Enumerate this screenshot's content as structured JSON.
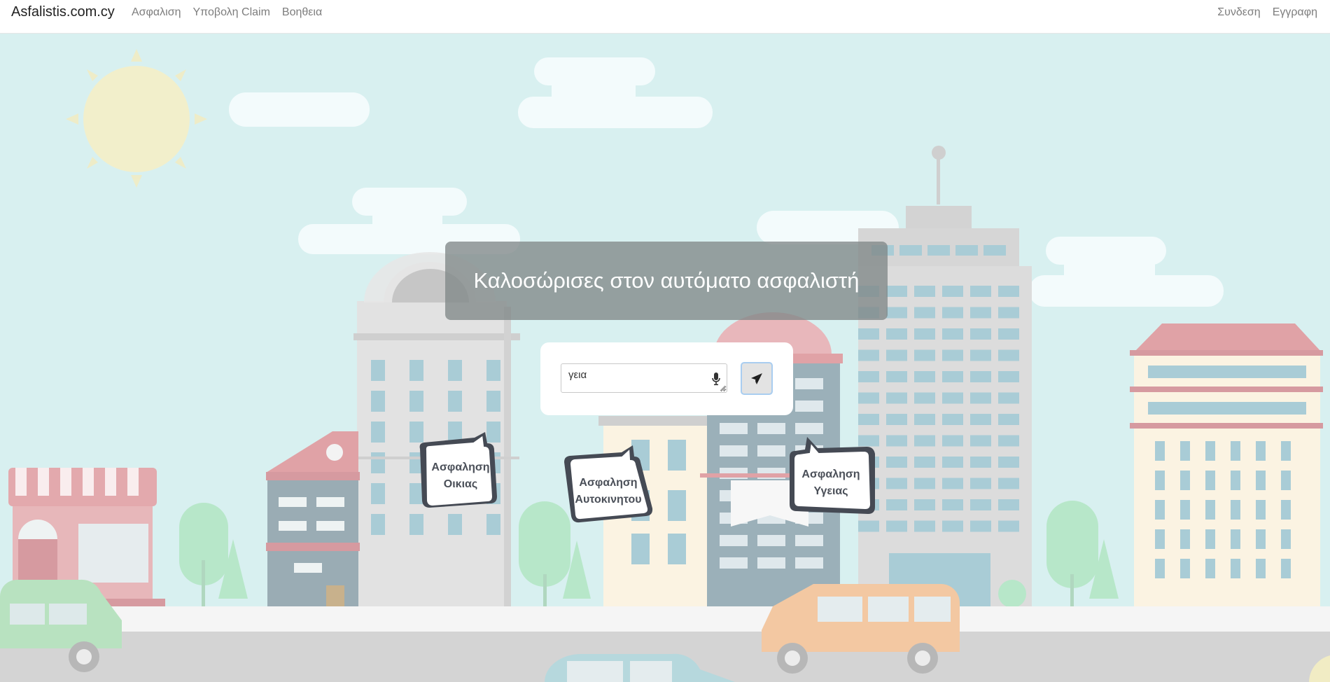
{
  "navbar": {
    "brand": "Asfalistis.com.cy",
    "left_links": [
      {
        "label": "Ασφαλιση"
      },
      {
        "label": "Υποβολη Claim"
      },
      {
        "label": "Βοηθεια"
      }
    ],
    "right_links": [
      {
        "label": "Συνδεση"
      },
      {
        "label": "Εγγραφη"
      }
    ]
  },
  "welcome": {
    "title": "Καλοσώρισες στον αυτόματο ασφαλιστή"
  },
  "chat": {
    "input_value": "γεια",
    "mic_icon": "microphone-icon",
    "send_icon": "paper-plane-icon"
  },
  "quick_options": [
    {
      "line1": "Ασφαληση",
      "line2": "Οικιας"
    },
    {
      "line1": "Ασφαληση",
      "line2": "Αυτοκινητου"
    },
    {
      "line1": "Ασφαληση",
      "line2": "Υγειας"
    }
  ],
  "colors": {
    "sky": "#d8f0f0",
    "bubble_text": "#4a4f58",
    "send_border": "#a9cdf0",
    "banner": "#808888"
  }
}
